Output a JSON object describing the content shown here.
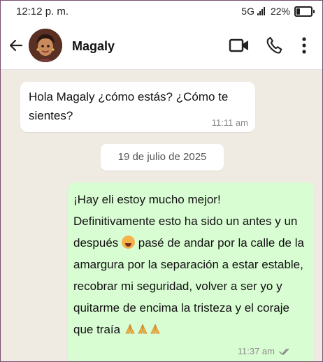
{
  "status_bar": {
    "time": "12:12 p. m.",
    "network": "5G",
    "battery": "22%"
  },
  "header": {
    "contact_name": "Magaly"
  },
  "messages": [
    {
      "direction": "incoming",
      "text": "Hola Magaly ¿cómo estás? ¿Cómo te sientes?",
      "time": "11:11 am"
    },
    {
      "direction": "outgoing",
      "text_part1": "¡Hay eli estoy mucho mejor! Definitivamente esto ha sido un antes y un después",
      "text_part2": "pasé de andar por la calle de la amargura por la separación a estar estable, recobrar mi seguridad, volver a ser yo y quitarme de encima la tristeza y el coraje que traía",
      "time": "11:37 am",
      "status": "read"
    }
  ],
  "date_separator": "19 de julio de 2025",
  "colors": {
    "chat_background": "#efeae2",
    "outgoing_bubble": "#d9fdd3",
    "incoming_bubble": "#ffffff",
    "read_check": "#8a8a8a"
  },
  "icons": {
    "back": "arrow-left-icon",
    "video": "video-camera-icon",
    "call": "phone-icon",
    "menu": "more-vertical-icon",
    "emoji_1": "exploding-head-emoji",
    "emoji_2": "folded-hands-emoji"
  }
}
